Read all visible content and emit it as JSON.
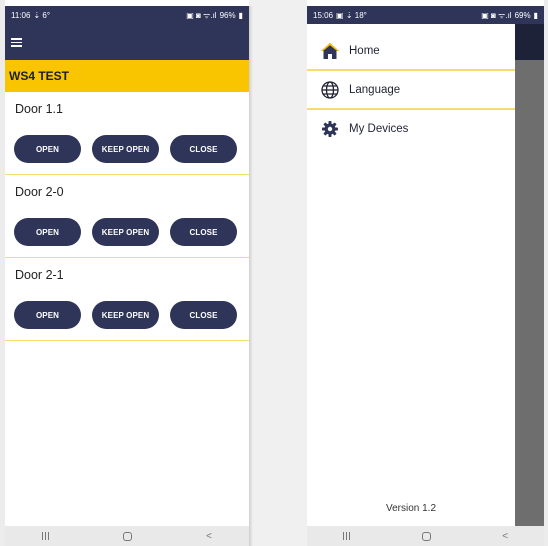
{
  "left_screen": {
    "status": {
      "time": "11:06",
      "left_icons": "⇣ 6°",
      "right_icons": "▣ ◙ ᯤ.ıl",
      "battery": "96%"
    },
    "group_title": "WS4 TEST",
    "doors": [
      {
        "name": "Door 1.1",
        "buttons": [
          "OPEN",
          "KEEP OPEN",
          "CLOSE"
        ]
      },
      {
        "name": "Door 2-0",
        "buttons": [
          "OPEN",
          "KEEP OPEN",
          "CLOSE"
        ]
      },
      {
        "name": "Door 2-1",
        "buttons": [
          "OPEN",
          "KEEP OPEN",
          "CLOSE"
        ]
      }
    ]
  },
  "right_screen": {
    "status": {
      "time": "15:06",
      "left_icons": "▣ ⇣ 18°",
      "right_icons": "▣ ◙ ᯤ.ıl",
      "battery": "69%"
    },
    "menu": [
      {
        "label": "Home",
        "icon": "home-icon"
      },
      {
        "label": "Language",
        "icon": "globe-icon"
      },
      {
        "label": "My Devices",
        "icon": "gear-icon"
      }
    ],
    "version": "Version 1.2"
  },
  "nav": {
    "back_glyph": "<"
  },
  "colors": {
    "primary": "#2f3559",
    "accent": "#f9c500",
    "divider": "#f5dc6e",
    "scrim": "#6e6e6e"
  }
}
